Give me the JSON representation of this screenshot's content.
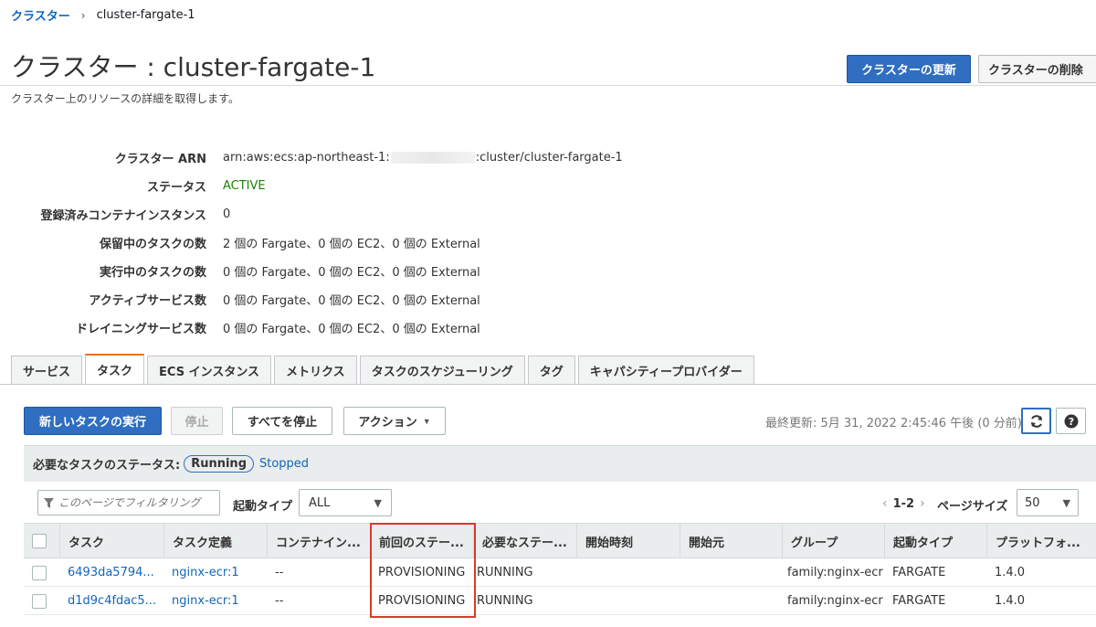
{
  "breadcrumb": {
    "parent": "クラスター",
    "separator": "›",
    "current": "cluster-fargate-1"
  },
  "header": {
    "title": "クラスター : cluster-fargate-1",
    "subtitle": "クラスター上のリソースの詳細を取得します。",
    "update_button": "クラスターの更新",
    "delete_button": "クラスターの削除"
  },
  "details": {
    "arn_label": "クラスター ARN",
    "arn_prefix": "arn:aws:ecs:ap-northeast-1:",
    "arn_suffix": ":cluster/cluster-fargate-1",
    "status_label": "ステータス",
    "status_value": "ACTIVE",
    "registered_label": "登録済みコンテナインスタンス",
    "registered_value": "0",
    "pending_label": "保留中のタスクの数",
    "pending_value": "2 個の Fargate、0 個の EC2、0 個の External",
    "running_label": "実行中のタスクの数",
    "running_value": "0 個の Fargate、0 個の EC2、0 個の External",
    "active_services_label": "アクティブサービス数",
    "active_services_value": "0 個の Fargate、0 個の EC2、0 個の External",
    "draining_label": "ドレイニングサービス数",
    "draining_value": "0 個の Fargate、0 個の EC2、0 個の External"
  },
  "tabs": [
    "サービス",
    "タスク",
    "ECS インスタンス",
    "メトリクス",
    "タスクのスケジューリング",
    "タグ",
    "キャパシティープロバイダー"
  ],
  "toolbar": {
    "run_task": "新しいタスクの実行",
    "stop": "停止",
    "stop_all": "すべてを停止",
    "actions": "アクション",
    "last_updated": "最終更新: 5月 31, 2022 2:45:46 午後 (0 分前)"
  },
  "status_filter": {
    "label": "必要なタスクのステータス:",
    "running": "Running",
    "stopped": "Stopped"
  },
  "filter": {
    "placeholder": "このページでフィルタリング",
    "launch_type_label": "起動タイプ",
    "launch_type_value": "ALL",
    "page_range": "1-2",
    "page_size_label": "ページサイズ",
    "page_size_value": "50"
  },
  "table": {
    "headers": [
      "タスク",
      "タスク定義",
      "コンテナイン...",
      "前回のステー...",
      "必要なステー...",
      "開始時刻",
      "開始元",
      "グループ",
      "起動タイプ",
      "プラットフォ..."
    ],
    "rows": [
      [
        "6493da5794...",
        "nginx-ecr:1",
        "--",
        "PROVISIONING",
        "RUNNING",
        "",
        "",
        "family:nginx-ecr",
        "FARGATE",
        "1.4.0"
      ],
      [
        "d1d9c4fdac5...",
        "nginx-ecr:1",
        "--",
        "PROVISIONING",
        "RUNNING",
        "",
        "",
        "family:nginx-ecr",
        "FARGATE",
        "1.4.0"
      ]
    ]
  },
  "colors": {
    "primary": "#2f6ec0",
    "link": "#1166bb",
    "active": "#1d8102",
    "tab_accent": "#ec7211",
    "highlight": "#d93a2b"
  },
  "icons": [
    "chevron-right-icon",
    "caret-down-icon",
    "refresh-icon",
    "help-icon",
    "filter-icon"
  ]
}
